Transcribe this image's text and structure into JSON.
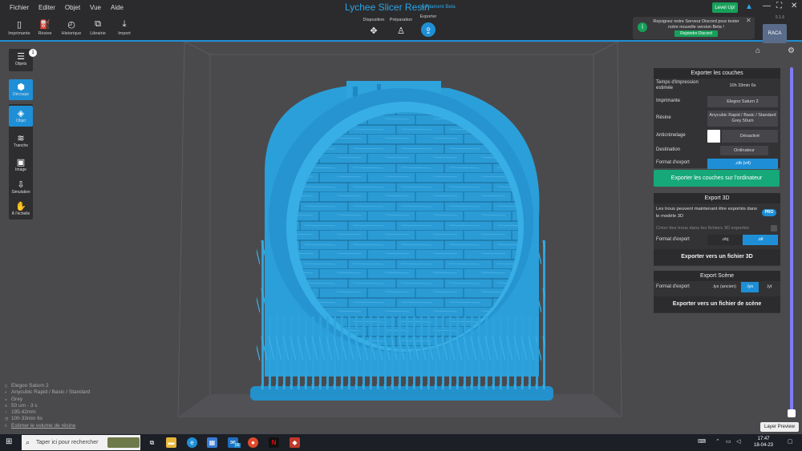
{
  "menu": [
    "Fichier",
    "Editer",
    "Objet",
    "Vue",
    "Aide"
  ],
  "app": {
    "title": "Lychee Slicer Resin",
    "subtitle": "& Filament Beta",
    "version": "5.1.6",
    "level_up": "Level Up!"
  },
  "toolbar": {
    "tools": [
      {
        "label": "Imprimante",
        "icon": "▯"
      },
      {
        "label": "Résine",
        "icon": "⛽"
      },
      {
        "label": "Historique",
        "icon": "◴"
      },
      {
        "label": "Librairie",
        "icon": "⧉"
      },
      {
        "label": "Import",
        "icon": "⤓"
      }
    ],
    "modes": [
      {
        "label": "Disposition",
        "icon": "✥"
      },
      {
        "label": "Préparation",
        "icon": "♙"
      },
      {
        "label": "Exporter",
        "icon": "⇪"
      }
    ]
  },
  "toast": {
    "message": "Rejoignez notre Serveur Discord pour tester notre nouvelle version Beta !",
    "button": "Rejoindre Discord"
  },
  "profile_badge": "RACA",
  "sidebar": {
    "objects": {
      "label": "Objets",
      "count": "1",
      "icon": "☰"
    },
    "items": [
      {
        "label": "Découpe",
        "icon": "⬢"
      },
      {
        "label": "Objet",
        "icon": "◈"
      },
      {
        "label": "Tranche",
        "icon": "≋"
      },
      {
        "label": "Image",
        "icon": "▣"
      },
      {
        "label": "Simulation",
        "icon": "⇩"
      },
      {
        "label": "À l'échelle",
        "icon": "✋"
      }
    ]
  },
  "export_layers": {
    "title": "Exporter les couches",
    "print_time_label": "Temps d'impression estimée",
    "print_time_value": "10h 33min 6s",
    "printer_label": "Imprimante",
    "printer_value": "Elegoo Saturn 2",
    "resin_label": "Résine",
    "resin_value": "Anycubic Rapid / Basic / Standard Grey 50um",
    "aa_label": "Anticrénelage",
    "aa_value": "Désactivé",
    "dest_label": "Destination",
    "dest_value": "Ordinateur",
    "format_label": "Format d'export",
    "format_value": ".ctb (v4)",
    "export_button": "Exporter les couches sur l'ordinateur"
  },
  "export_3d": {
    "title": "Export 3D",
    "notice": "Les trous peuvent maintenant être exportés dans le modèle 3D",
    "pro": "PRO",
    "holes_option": "Créer des trous dans les fichiers 3D exportés",
    "format_label": "Format d'export",
    "formats": [
      ".obj",
      ".stl"
    ],
    "selected_format": ".stl",
    "export_button": "Exporter vers un fichier 3D"
  },
  "export_scene": {
    "title": "Export Scène",
    "format_label": "Format d'export",
    "formats": [
      ".lys (ancien)",
      ".lys",
      ".lyt"
    ],
    "selected_format": ".lys",
    "export_button": "Exporter vers un fichier de scène"
  },
  "info": {
    "printer": "Elegoo Saturn 2",
    "resin": "Anycubic Rapid / Basic / Standard",
    "resin_color": "Grey",
    "layer": "50 um - 3 s",
    "height": "195.42mm",
    "time": "10h 33min 6s",
    "estimate_link": "Estimer le volume de résine"
  },
  "layer_slider": {
    "tooltip": "Layer Preview",
    "position": 1.0
  },
  "taskbar": {
    "search_placeholder": "Taper ici pour rechercher",
    "time": "17:47",
    "date": "18-04-23",
    "mail_count": "56"
  },
  "colors": {
    "accent": "#1e8fd6",
    "model": "#2ea3dc",
    "green": "#16a878",
    "background": "#4a4a4d"
  }
}
